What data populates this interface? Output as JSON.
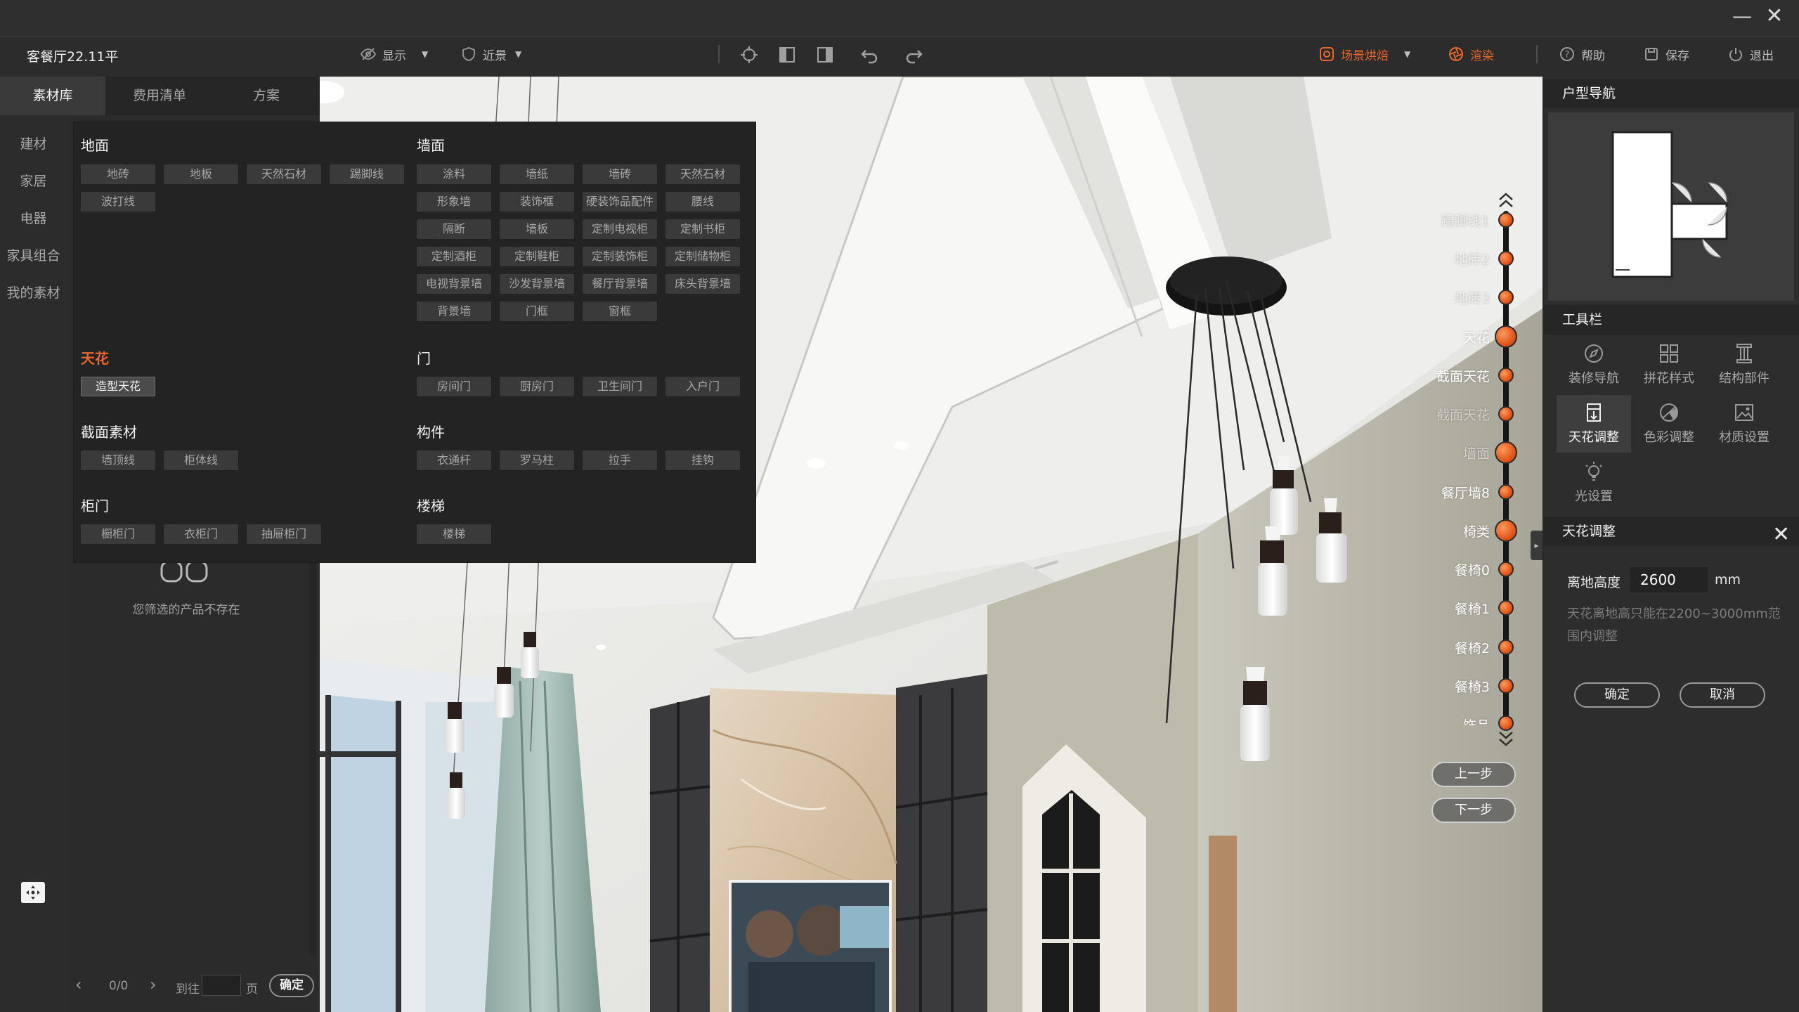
{
  "window": {
    "minimize_glyph": "—",
    "close_glyph": "✕"
  },
  "toolbar": {
    "room_title": "客餐厅22.11平",
    "display_label": "显示",
    "view_label": "近景",
    "scene_bake_label": "场景烘焙",
    "render_label": "渲染",
    "help_label": "帮助",
    "save_label": "保存",
    "exit_label": "退出",
    "accent_color": "#e8662f"
  },
  "left_panel": {
    "tabs": [
      {
        "label": "素材库",
        "active": true
      },
      {
        "label": "费用清单",
        "active": false
      },
      {
        "label": "方案",
        "active": false
      }
    ],
    "categories": [
      "建材",
      "家居",
      "电器",
      "家具组合",
      "我的素材"
    ],
    "empty_message": "您筛选的产品不存在",
    "pager": {
      "prev_glyph": "‹",
      "next_glyph": "›",
      "count": "0/0",
      "goto_label": "到往",
      "page_label": "页",
      "confirm_label": "确定"
    }
  },
  "dropdown": {
    "groups": [
      {
        "title": "地面",
        "items": [
          "地砖",
          "地板",
          "天然石材",
          "踢脚线",
          "波打线"
        ]
      },
      {
        "title": "墙面",
        "items": [
          "涂料",
          "墙纸",
          "墙砖",
          "天然石材",
          "形象墙",
          "装饰框",
          "硬装饰品配件",
          "腰线",
          "隔断",
          "墙板",
          "定制电视柜",
          "定制书柜",
          "定制酒柜",
          "定制鞋柜",
          "定制装饰柜",
          "定制储物柜",
          "电视背景墙",
          "沙发背景墙",
          "餐厅背景墙",
          "床头背景墙",
          "背景墙",
          "门框",
          "窗框"
        ]
      },
      {
        "title": "天花",
        "items": [
          "造型天花"
        ],
        "selected": "造型天花"
      },
      {
        "title": "门",
        "items": [
          "房间门",
          "厨房门",
          "卫生间门",
          "入户门"
        ]
      },
      {
        "title": "截面素材",
        "items": [
          "墙顶线",
          "柜体线"
        ]
      },
      {
        "title": "构件",
        "items": [
          "衣通杆",
          "罗马柱",
          "拉手",
          "挂钩"
        ]
      },
      {
        "title": "柜门",
        "items": [
          "橱柜门",
          "衣柜门",
          "抽屉柜门"
        ]
      },
      {
        "title": "楼梯",
        "items": [
          "楼梯"
        ]
      }
    ]
  },
  "timeline": {
    "steps": [
      "踢脚线1",
      "地砖2",
      "地砖3",
      "天花",
      "截面天花",
      "截面天花",
      "墙面",
      "餐厅墙8",
      "椅类",
      "餐椅0",
      "餐椅1",
      "餐椅2",
      "餐椅3",
      "饰品"
    ],
    "prev_label": "上一步",
    "next_label": "下一步"
  },
  "right_panel": {
    "nav_title": "户型导航",
    "tools_title": "工具栏",
    "tools": [
      "装修导航",
      "拼花样式",
      "结构部件",
      "天花调整",
      "色彩调整",
      "材质设置",
      "光设置"
    ],
    "active_tool": "天花调整",
    "ceiling": {
      "title": "天花调整",
      "height_label": "离地高度",
      "height_value": "2600",
      "unit": "mm",
      "tip": "天花离地高只能在2200~3000mm范围内调整",
      "confirm_label": "确定",
      "cancel_label": "取消"
    }
  }
}
